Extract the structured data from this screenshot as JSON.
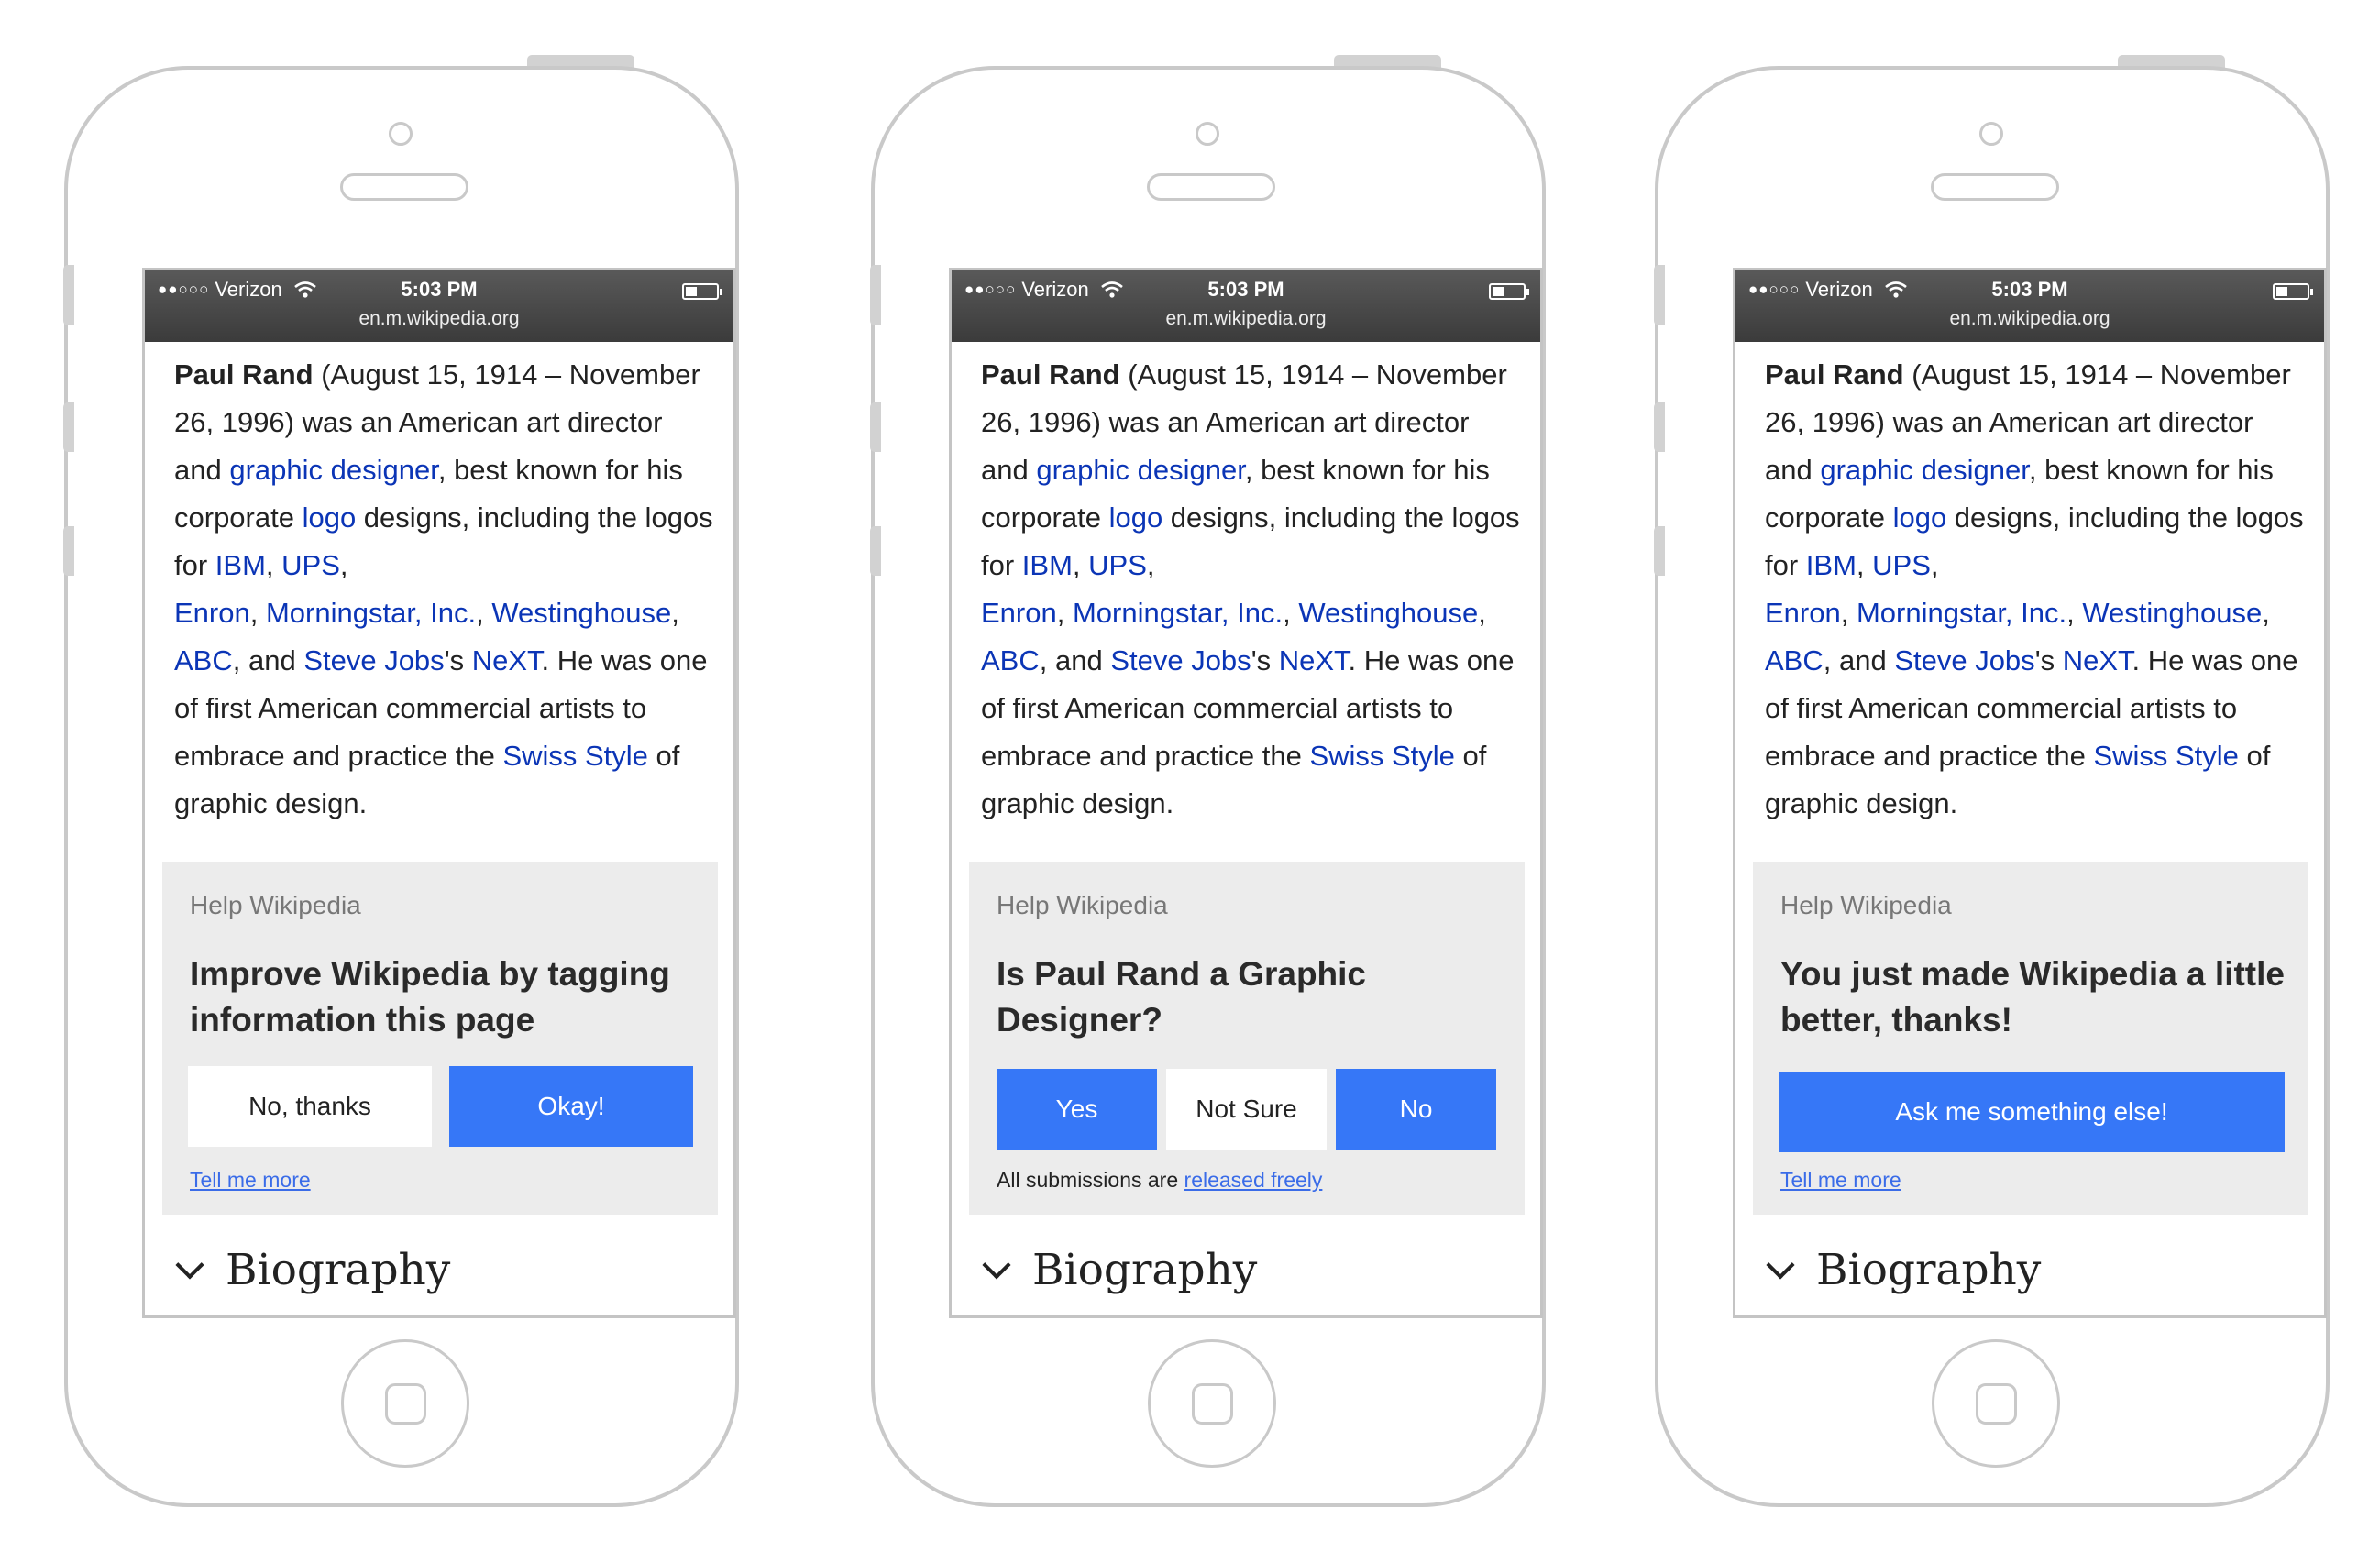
{
  "status": {
    "dots": "●●○○○",
    "carrier": "Verizon",
    "time": "5:03 PM",
    "url": "en.m.wikipedia.org"
  },
  "article": {
    "t1": "Paul Rand",
    "t2": " (August 15, 1914 – November 26, 1996) was an American art director and ",
    "l1": "graphic designer",
    "t3": ", best known for his corporate ",
    "l2": "logo",
    "t4": " designs, including the logos for ",
    "l3": "IBM",
    "t5": ", ",
    "l4": "UPS",
    "t6": ", ",
    "l5": "Enron",
    "t7": ", ",
    "l6": "Morningstar, Inc.",
    "t8": ", ",
    "l7": "Westinghouse",
    "t9": ", ",
    "l8": "ABC",
    "t10": ", and ",
    "l9": "Steve Jobs",
    "t11": "'s ",
    "l10": "NeXT",
    "t12": ". He was one of first American commercial artists to embrace and practice the ",
    "l11": "Swiss Style",
    "t13": " of graphic design."
  },
  "section_title": "Biography",
  "cards": {
    "one": {
      "label": "Help Wikipedia",
      "title": "Improve Wikipedia by tagging information this page",
      "no_thanks": "No, thanks",
      "okay": "Okay!",
      "tell_more": "Tell me more"
    },
    "two": {
      "label": "Help Wikipedia",
      "title": "Is Paul Rand a Graphic Designer?",
      "yes": "Yes",
      "not_sure": "Not Sure",
      "no": "No",
      "note": "All submissions are ",
      "note_link": "released freely"
    },
    "three": {
      "label": "Help Wikipedia",
      "title": "You just made Wikipedia a little better, thanks!",
      "ask": "Ask me something else!",
      "tell_more": "Tell me more"
    }
  },
  "colors": {
    "link": "#0b35b6",
    "button_blue": "#3677f7",
    "card_bg": "#ececec"
  }
}
